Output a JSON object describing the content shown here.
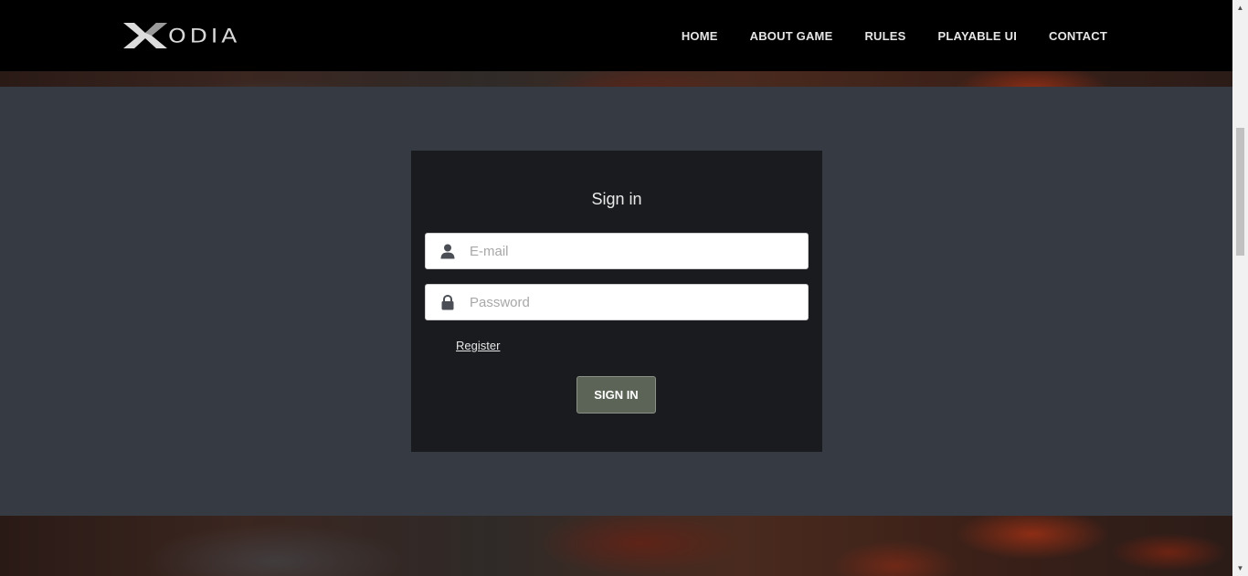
{
  "brand": {
    "logo_text": "ODIA",
    "logo_mark": "X"
  },
  "nav": {
    "items": [
      {
        "label": "HOME"
      },
      {
        "label": "ABOUT GAME"
      },
      {
        "label": "RULES"
      },
      {
        "label": "PLAYABLE UI"
      },
      {
        "label": "CONTACT"
      }
    ]
  },
  "signin": {
    "title": "Sign in",
    "email_placeholder": "E-mail",
    "password_placeholder": "Password",
    "email_icon": "user-icon",
    "password_icon": "lock-icon",
    "register_label": "Register",
    "button_label": "SIGN IN"
  },
  "colors": {
    "page_bg": "#363a42",
    "card_bg": "#1a1b1f",
    "nav_bg": "#000000",
    "button_bg": "#5c6458"
  }
}
